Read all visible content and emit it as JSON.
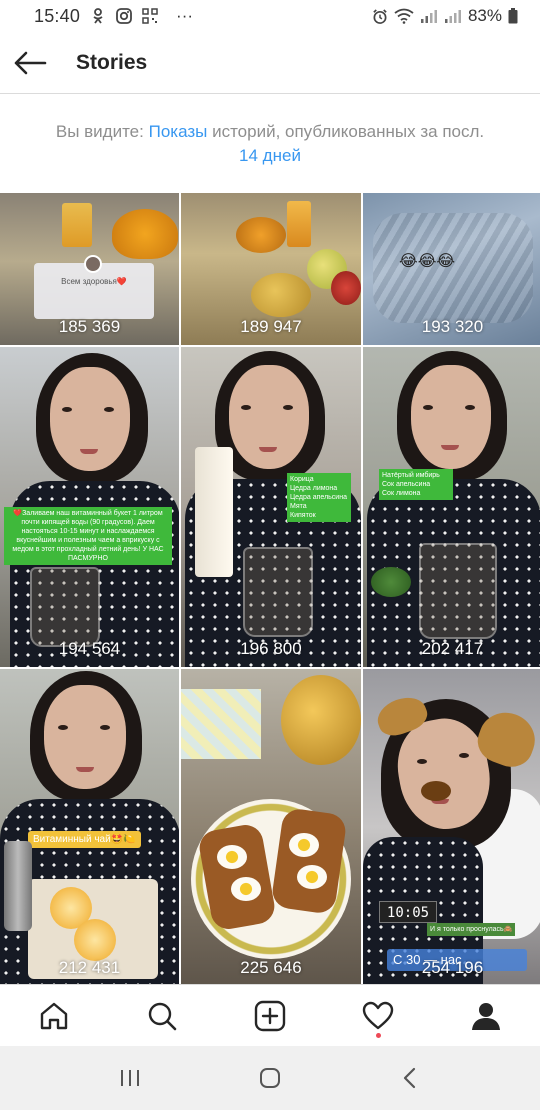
{
  "status_bar": {
    "time": "15:40",
    "battery": "83%",
    "more": "···"
  },
  "header": {
    "title": "Stories"
  },
  "info": {
    "prefix": "Вы видите: ",
    "link": "Показы",
    "suffix": " историй, опубликованных за посл.",
    "period": "14 дней"
  },
  "stories": [
    {
      "views": "185 369",
      "sticker": "Всем здоровья❤️"
    },
    {
      "views": "189 947"
    },
    {
      "views": "193 320",
      "emojis": "😂😂😂"
    },
    {
      "views": "194 564",
      "caption": "❤️Заливаем наш витаминный букет 1 литром почти кипящей воды (90 градусов). Даем настояться 10-15 минут и наслаждаемся вкуснейшим и полезным чаем а вприкуску с медом в этот прохладный летний день! У НАС ПАСМУРНО"
    },
    {
      "views": "196 800",
      "list": [
        "Корица",
        "Цедра лимона",
        "Цедра апельсина",
        "Мята",
        "Кипяток"
      ]
    },
    {
      "views": "202 417",
      "list": [
        "Натёртый имбирь",
        "Сок апельсина",
        "Сок лимона"
      ]
    },
    {
      "views": "212 431",
      "caption": "Витаминный чай🤩🍋"
    },
    {
      "views": "225 646"
    },
    {
      "views": "254 196",
      "clock": "10:05",
      "caption": "И я только проснулась🙈",
      "badge": "С 30 — нас"
    }
  ],
  "colors": {
    "link": "#3897f0",
    "notification": "#ed4956",
    "sticker_green": "#3fb93b"
  },
  "nav": [
    "home-icon",
    "search-icon",
    "add-icon",
    "heart-icon",
    "profile-icon"
  ]
}
